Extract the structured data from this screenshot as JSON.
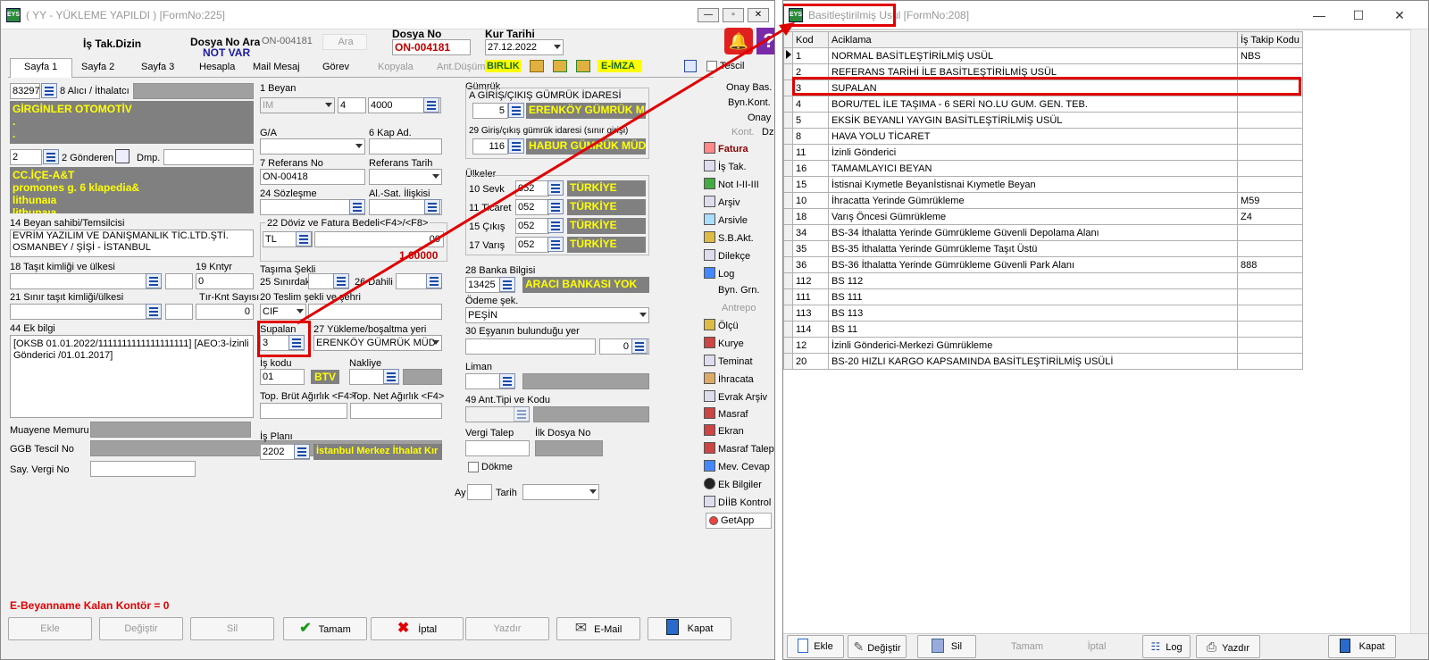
{
  "left_window": {
    "title": "( YY  - YÜKLEME YAPILDI ) [FormNo:225]",
    "header": {
      "is_tak_dizin": "İş Tak.Dizin",
      "dosya_no_ara": "Dosya No Ara",
      "dosya_no_ara_value": "ON-004181",
      "ara_btn": "Ara",
      "not_var": "NOT VAR",
      "dosya_no_label": "Dosya No",
      "dosya_no_value": "ON-004181",
      "kur_tarihi_label": "Kur Tarihi",
      "kur_tarihi_value": "27.12.2022"
    },
    "tabs": [
      "Sayfa 1",
      "Sayfa 2",
      "Sayfa 3",
      "Hesapla",
      "Mail Mesaj",
      "Görev",
      "Kopyala",
      "Ant.Düşüm"
    ],
    "badges": {
      "birlik": "BIRLIK",
      "eimza": "E-İMZA",
      "tescil": "Tescil"
    },
    "alici": {
      "code": "83297",
      "label": "8 Alıcı / İthalatcı",
      "text": "GİRGİNLER OTOMOTİV\n.\n.\n."
    },
    "gonderen": {
      "code": "2",
      "label": "2 Gönderen",
      "dmp": "Dmp.",
      "text": "CC.İÇE-A&T\npromones g. 6 klapedia&\nlithunaıa\nlithunaıa"
    },
    "beyan_sahibi": {
      "label": "14 Beyan sahibi/Temsilcisi",
      "text": "EVRİM YAZILIM VE DANIŞMANLIK TİC.LTD.ŞTİ.\nOSMANBEY / ŞİŞİ - İSTANBUL"
    },
    "tasit": {
      "label": "18 Taşıt kimliği ve ülkesi",
      "kntyr_label": "19 Kntyr",
      "kntyr_value": "0"
    },
    "sinir_tasit": {
      "label": "21 Sınır taşıt kimliği/ülkesi",
      "tir_label": "Tır-Knt Sayısı",
      "tir_value": "0"
    },
    "ek_bilgi": {
      "label": "44 Ek bilgi",
      "text": "[OKSB 01.01.2022/1111111111111111111] [AEO:3-İzinli Gönderici /01.01.2017]"
    },
    "muayene_label": "Muayene Memuru",
    "ggb_label": "GGB Tescil No",
    "vergi_label": "Say. Vergi No",
    "beyan": {
      "label": "1 Beyan",
      "v1": "IM",
      "v2": "4",
      "v3": "4000"
    },
    "ga_label": "G/A",
    "kap_label": "6 Kap Ad.",
    "referans": {
      "label": "7 Referans No",
      "value": "ON-00418",
      "tarih_label": "Referans Tarih"
    },
    "sozlesme_label": "24 Sözleşme",
    "alsat_label": "Al.-Sat. İlişkisi",
    "doviz": {
      "label": "22 Döviz ve Fatura Bedeli<F4>/<F8>",
      "currency": "TL",
      "amount": "00",
      "rate": "1.00000"
    },
    "tasima": {
      "label": "Taşıma Şekli",
      "sinir_label": "25 Sınırdaki",
      "dahili_label": "26 Dahili"
    },
    "teslim": {
      "label": "20 Teslim şekli ve şehri",
      "value": "CIF"
    },
    "supalan": {
      "label": "Supalan",
      "value": "3"
    },
    "yukleme": {
      "label": "27 Yükleme/boşaltma yeri",
      "value": "ERENKÖY GÜMRÜK MÜD"
    },
    "is_kodu": {
      "label": "İş kodu",
      "value": "01",
      "btv": "BTV",
      "nakliye_label": "Nakliye"
    },
    "agirlik": {
      "brut_label": "Top. Brüt Ağırlık <F4>",
      "net_label": "Top. Net Ağırlık <F4>"
    },
    "is_plani": {
      "label": "İş Planı",
      "code": "2202",
      "text": "İstanbul Merkez İthalat Kır"
    },
    "gumruk": {
      "label": "Gümrük",
      "a_label": "A GİRİŞ/ÇIKIŞ GÜMRÜK İDARESİ",
      "a_code": "5",
      "a_text": "ERENKÖY GÜMRÜK MÜ",
      "b_label": "29 Giriş/çıkış gümrük idaresi (sınır girişi)",
      "b_code": "116",
      "b_text": "HABUR GÜMRÜK MÜD"
    },
    "ulkeler": {
      "label": "Ülkeler",
      "rows": [
        {
          "label": "10 Sevk",
          "code": "052",
          "text": "TÜRKİYE"
        },
        {
          "label": "11 Ticaret",
          "code": "052",
          "text": "TÜRKİYE"
        },
        {
          "label": "15 Çıkış",
          "code": "052",
          "text": "TÜRKİYE"
        },
        {
          "label": "17 Varış",
          "code": "052",
          "text": "TÜRKİYE"
        }
      ]
    },
    "banka": {
      "label": "28 Banka Bilgisi",
      "code": "13425",
      "text": "ARACI BANKASI YOK"
    },
    "odeme": {
      "label": "Ödeme şek.",
      "value": "PEŞİN"
    },
    "esya": {
      "label": "30 Eşyanın bulunduğu yer",
      "value": "0"
    },
    "liman_label": "Liman",
    "ant_label": "49 Ant.Tipi ve Kodu",
    "vergi_talep_label": "Vergi Talep",
    "ilk_dosya_label": "İlk Dosya No",
    "dokme_label": "Dökme",
    "ay_label": "Ay",
    "tarih_label": "Tarih",
    "right_checks": {
      "onay_bas": "Onay Bas.",
      "byn_kont": "Byn.Kont.",
      "onay": "Onay",
      "kont": "Kont.",
      "dzlt": "Dzlt"
    },
    "side_menu": [
      "Fatura",
      "İş Tak.",
      "Not I-II-III",
      "Arşiv",
      "Arsivle",
      "S.B.Akt.",
      "Dilekçe",
      "Log",
      "Byn. Grn.",
      "Antrepo",
      "Ölçü",
      "Kurye",
      "Teminat",
      "İhracata",
      "Evrak Arşiv",
      "Masraf",
      "Ekran",
      "Masraf Talep",
      "Mev. Cevap",
      "Ek Bilgiler",
      "DİİB Kontrol",
      "GetApp"
    ],
    "footer_msg": "E-Beyanname Kalan Kontör = 0",
    "buttons": {
      "ekle": "Ekle",
      "degistir": "Değiştir",
      "sil": "Sil",
      "tamam": "Tamam",
      "iptal": "İptal",
      "yazdir": "Yazdır",
      "email": "E-Mail",
      "kapat": "Kapat"
    }
  },
  "right_window": {
    "title": "Basitleştirilmiş Usul [FormNo:208]",
    "columns": [
      "Kod",
      "Aciklama",
      "İş Takip Kodu"
    ],
    "rows": [
      {
        "kod": "1",
        "aciklama": "NORMAL BASİTLEŞTİRİLMİŞ USÜL",
        "takip": "NBS"
      },
      {
        "kod": "2",
        "aciklama": "REFERANS TARİHİ İLE BASİTLEŞTİRİLMİŞ USÜL",
        "takip": ""
      },
      {
        "kod": "3",
        "aciklama": "SUPALAN",
        "takip": ""
      },
      {
        "kod": "4",
        "aciklama": "BORU/TEL İLE TAŞIMA - 6 SERİ NO.LU GUM. GEN. TEB.",
        "takip": ""
      },
      {
        "kod": "5",
        "aciklama": "EKSİK BEYANLI YAYGIN BASİTLEŞTİRİLMİŞ USÜL",
        "takip": ""
      },
      {
        "kod": "8",
        "aciklama": "HAVA YOLU TİCARET",
        "takip": ""
      },
      {
        "kod": "11",
        "aciklama": "İzinli Gönderici",
        "takip": ""
      },
      {
        "kod": "16",
        "aciklama": "TAMAMLAYICI BEYAN",
        "takip": ""
      },
      {
        "kod": "15",
        "aciklama": "İstisnai Kıymetle Beyanİstisnai Kıymetle Beyan",
        "takip": ""
      },
      {
        "kod": "10",
        "aciklama": "İhracatta Yerinde Gümrükleme",
        "takip": "M59"
      },
      {
        "kod": "18",
        "aciklama": "Varış Öncesi Gümrükleme",
        "takip": "Z4"
      },
      {
        "kod": "34",
        "aciklama": "BS-34 İthalatta Yerinde Gümrükleme Güvenli Depolama Alanı",
        "takip": ""
      },
      {
        "kod": "35",
        "aciklama": "BS-35 İthalatta Yerinde Gümrükleme Taşıt Üstü",
        "takip": ""
      },
      {
        "kod": "36",
        "aciklama": "BS-36 İthalatta Yerinde Gümrükleme Güvenli Park Alanı",
        "takip": "888"
      },
      {
        "kod": "112",
        "aciklama": "BS 112",
        "takip": ""
      },
      {
        "kod": "111",
        "aciklama": "BS 111",
        "takip": ""
      },
      {
        "kod": "113",
        "aciklama": "BS 113",
        "takip": ""
      },
      {
        "kod": "114",
        "aciklama": "BS 11",
        "takip": ""
      },
      {
        "kod": "12",
        "aciklama": "İzinli Gönderici-Merkezi Gümrükleme",
        "takip": ""
      },
      {
        "kod": "20",
        "aciklama": "BS-20 HIZLI KARGO KAPSAMINDA BASİTLEŞTİRİLMİŞ USÜLİ",
        "takip": ""
      }
    ],
    "buttons": {
      "ekle": "Ekle",
      "degistir": "Değiştir",
      "sil": "Sil",
      "tamam": "Tamam",
      "iptal": "İptal",
      "log": "Log",
      "yazdir": "Yazdır",
      "kapat": "Kapat"
    }
  },
  "colors": {
    "highlight": "#e00000",
    "yellow_text": "#ffff00",
    "field_gray": "#808080"
  }
}
